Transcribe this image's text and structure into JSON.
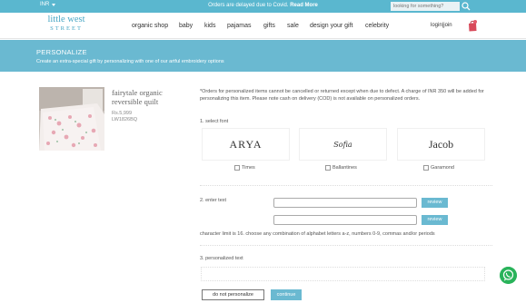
{
  "topbar": {
    "currency": "INR",
    "notice_text": "Orders are delayed due to Covid.",
    "notice_link": "Read More",
    "search_placeholder": "looking for something?",
    "search_icon": "search-icon"
  },
  "header": {
    "logo_line1": "little west",
    "logo_line2": "STREET",
    "nav": [
      "organic shop",
      "baby",
      "kids",
      "pajamas",
      "gifts",
      "sale",
      "design your gift",
      "celebrity"
    ],
    "login": "login|join",
    "cart_icon": "shopping-bag-icon"
  },
  "banner": {
    "title": "PERSONALIZE",
    "subtitle": "Create an extra-special gift by personalizing with one of our artful embroidery options"
  },
  "product": {
    "name": "fairytale organic reversible quilt",
    "price": "Rs.5,999",
    "sku": "LW1826BQ"
  },
  "personalize": {
    "note": "*Orders for personalized items cannot be cancelled or returned except when due to defect. A charge of INR 350 will be added for personalizing this item. Please note cash on delivery (COD) is not available on personalized orders.",
    "step1": "1. select font",
    "fonts": [
      {
        "sample": "ARYA",
        "name": "Times"
      },
      {
        "sample": "Sofia",
        "name": "Ballantines"
      },
      {
        "sample": "Jacob",
        "name": "Garamond"
      }
    ],
    "step2": "2. enter text",
    "review_label": "review",
    "char_limit": "character limit is 16. choose any combination of alphabet letters a-z, numbers 0-9, commas and/or periods",
    "step3": "3. personalized text",
    "no_personalize": "do not personalize",
    "continue": "continue"
  },
  "colors": {
    "accent": "#5ab7cf",
    "banner": "#6ab9d1",
    "whatsapp": "#29b35a"
  },
  "whatsapp_icon": "whatsapp-icon"
}
